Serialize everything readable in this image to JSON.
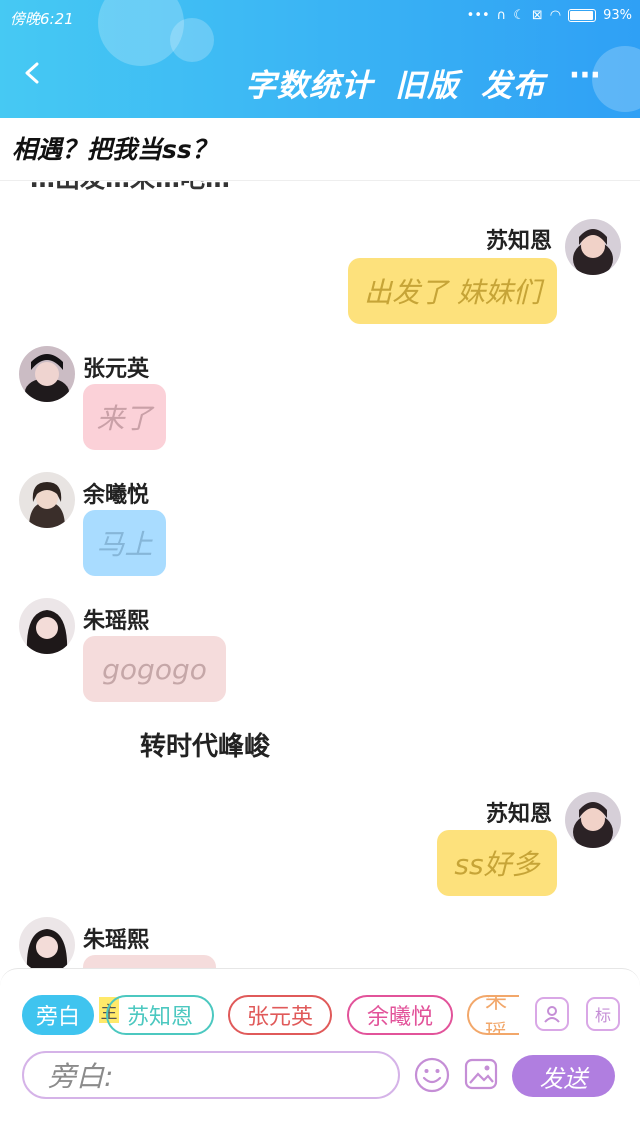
{
  "status_bar": {
    "time": "傍晚6:21",
    "battery": "93%"
  },
  "header": {
    "actions": [
      "字数统计",
      "旧版",
      "发布"
    ],
    "more": "···"
  },
  "title": "相遇？把我当ss？",
  "chat": {
    "cut_text": "…出发…来…吧…",
    "messages": [
      {
        "side": "right",
        "name": "苏知恩",
        "text": "出发了 妹妹们",
        "color": "#fde17c",
        "text_color": "#c6a437"
      },
      {
        "side": "left",
        "name": "张元英",
        "text": "来了",
        "color": "#fbd1d8",
        "text_color": "#c9a0a7"
      },
      {
        "side": "left",
        "name": "余曦悦",
        "text": "马上",
        "color": "#a9dcff",
        "text_color": "#86b6d8"
      },
      {
        "side": "left",
        "name": "朱瑶熙",
        "text": "gogogo",
        "color": "#f5dcdc",
        "text_color": "#c5a7a8"
      },
      {
        "side": "narration",
        "text": "转时代峰峻"
      },
      {
        "side": "right",
        "name": "苏知恩",
        "text": "ss好多",
        "color": "#fde17c",
        "text_color": "#c6a437"
      },
      {
        "side": "left",
        "name": "朱瑶熙",
        "text": "",
        "color": "#f5dcdc"
      }
    ]
  },
  "composer": {
    "chips": [
      {
        "label": "旁白",
        "color": "#3fc4ef",
        "active": true
      },
      {
        "label": "苏知恩",
        "color": "#4cc8c0",
        "active": false
      },
      {
        "label": "张元英",
        "color": "#e05a5a",
        "active": false
      },
      {
        "label": "余曦悦",
        "color": "#e2539a",
        "active": false
      },
      {
        "label": "朱瑶",
        "color": "#f2a76a",
        "active": false
      }
    ],
    "main_tag": "主",
    "mark_label": "标",
    "placeholder": "旁白:",
    "send": "发送"
  }
}
